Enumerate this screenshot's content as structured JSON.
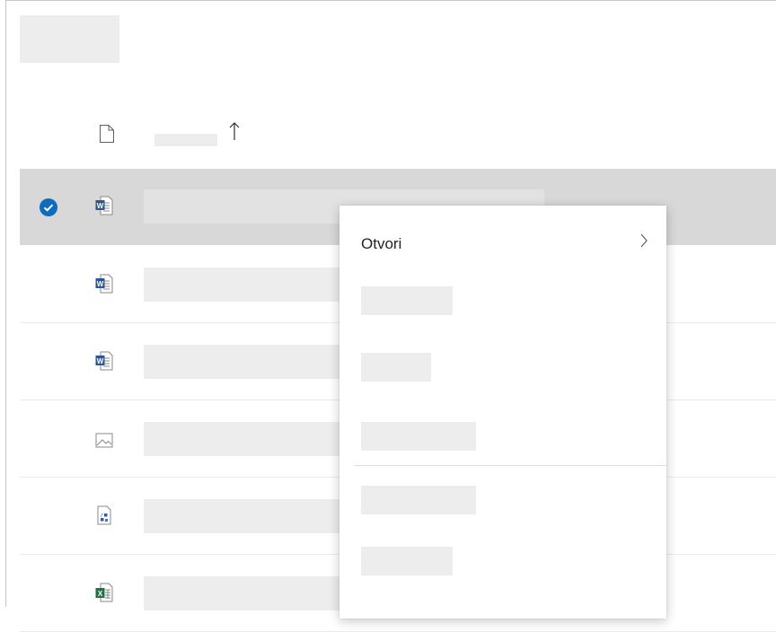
{
  "toolbar": {
    "command_placeholder_icon": "blank-button"
  },
  "list_header": {
    "file_type_icon": "document-outline-icon",
    "name_header": "",
    "sort_icon": "arrow-up-icon"
  },
  "files": [
    {
      "type": "word",
      "icon": "word-file-icon",
      "selected": true
    },
    {
      "type": "word",
      "icon": "word-file-icon",
      "selected": false
    },
    {
      "type": "word",
      "icon": "word-file-icon",
      "selected": false
    },
    {
      "type": "image",
      "icon": "image-file-icon",
      "selected": false
    },
    {
      "type": "visio",
      "icon": "visio-file-icon",
      "selected": false
    },
    {
      "type": "excel",
      "icon": "excel-file-icon",
      "selected": false
    }
  ],
  "context_menu": {
    "items": [
      {
        "label": "Otvori",
        "has_submenu": true
      },
      {
        "label": ""
      },
      {
        "label": ""
      },
      {
        "label": ""
      },
      {
        "label": ""
      },
      {
        "label": ""
      }
    ]
  },
  "colors": {
    "selected_row": "#d8d8d8",
    "accent": "#0f6cbd",
    "word": "#2b579a",
    "excel": "#217346",
    "placeholder": "#ededed"
  }
}
